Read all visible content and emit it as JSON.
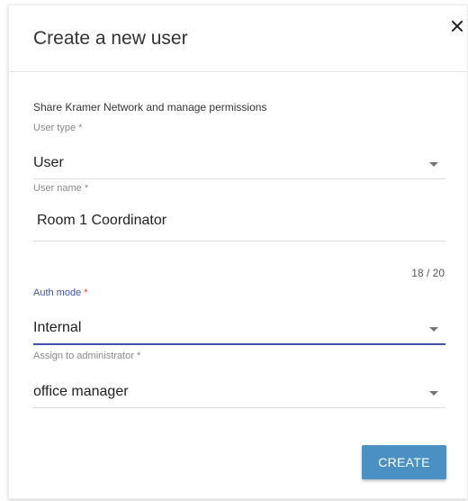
{
  "dialog": {
    "title": "Create a new user",
    "close_icon": "close-icon",
    "description": "Share Kramer Network and manage permissions"
  },
  "fields": {
    "user_type": {
      "label": "User type",
      "required": "*",
      "value": "User"
    },
    "user_name": {
      "label": "User name",
      "required": "*",
      "value": "Room 1 Coordinator",
      "counter": "18 / 20"
    },
    "auth_mode": {
      "label": "Auth mode",
      "required": "*",
      "value": "Internal"
    },
    "assign_admin": {
      "label": "Assign to administrator",
      "required": "*",
      "value": "office manager"
    }
  },
  "actions": {
    "create_label": "CREATE"
  },
  "colors": {
    "accent": "#3f51b5",
    "button": "#4a90c2",
    "required_active": "#e53935"
  }
}
